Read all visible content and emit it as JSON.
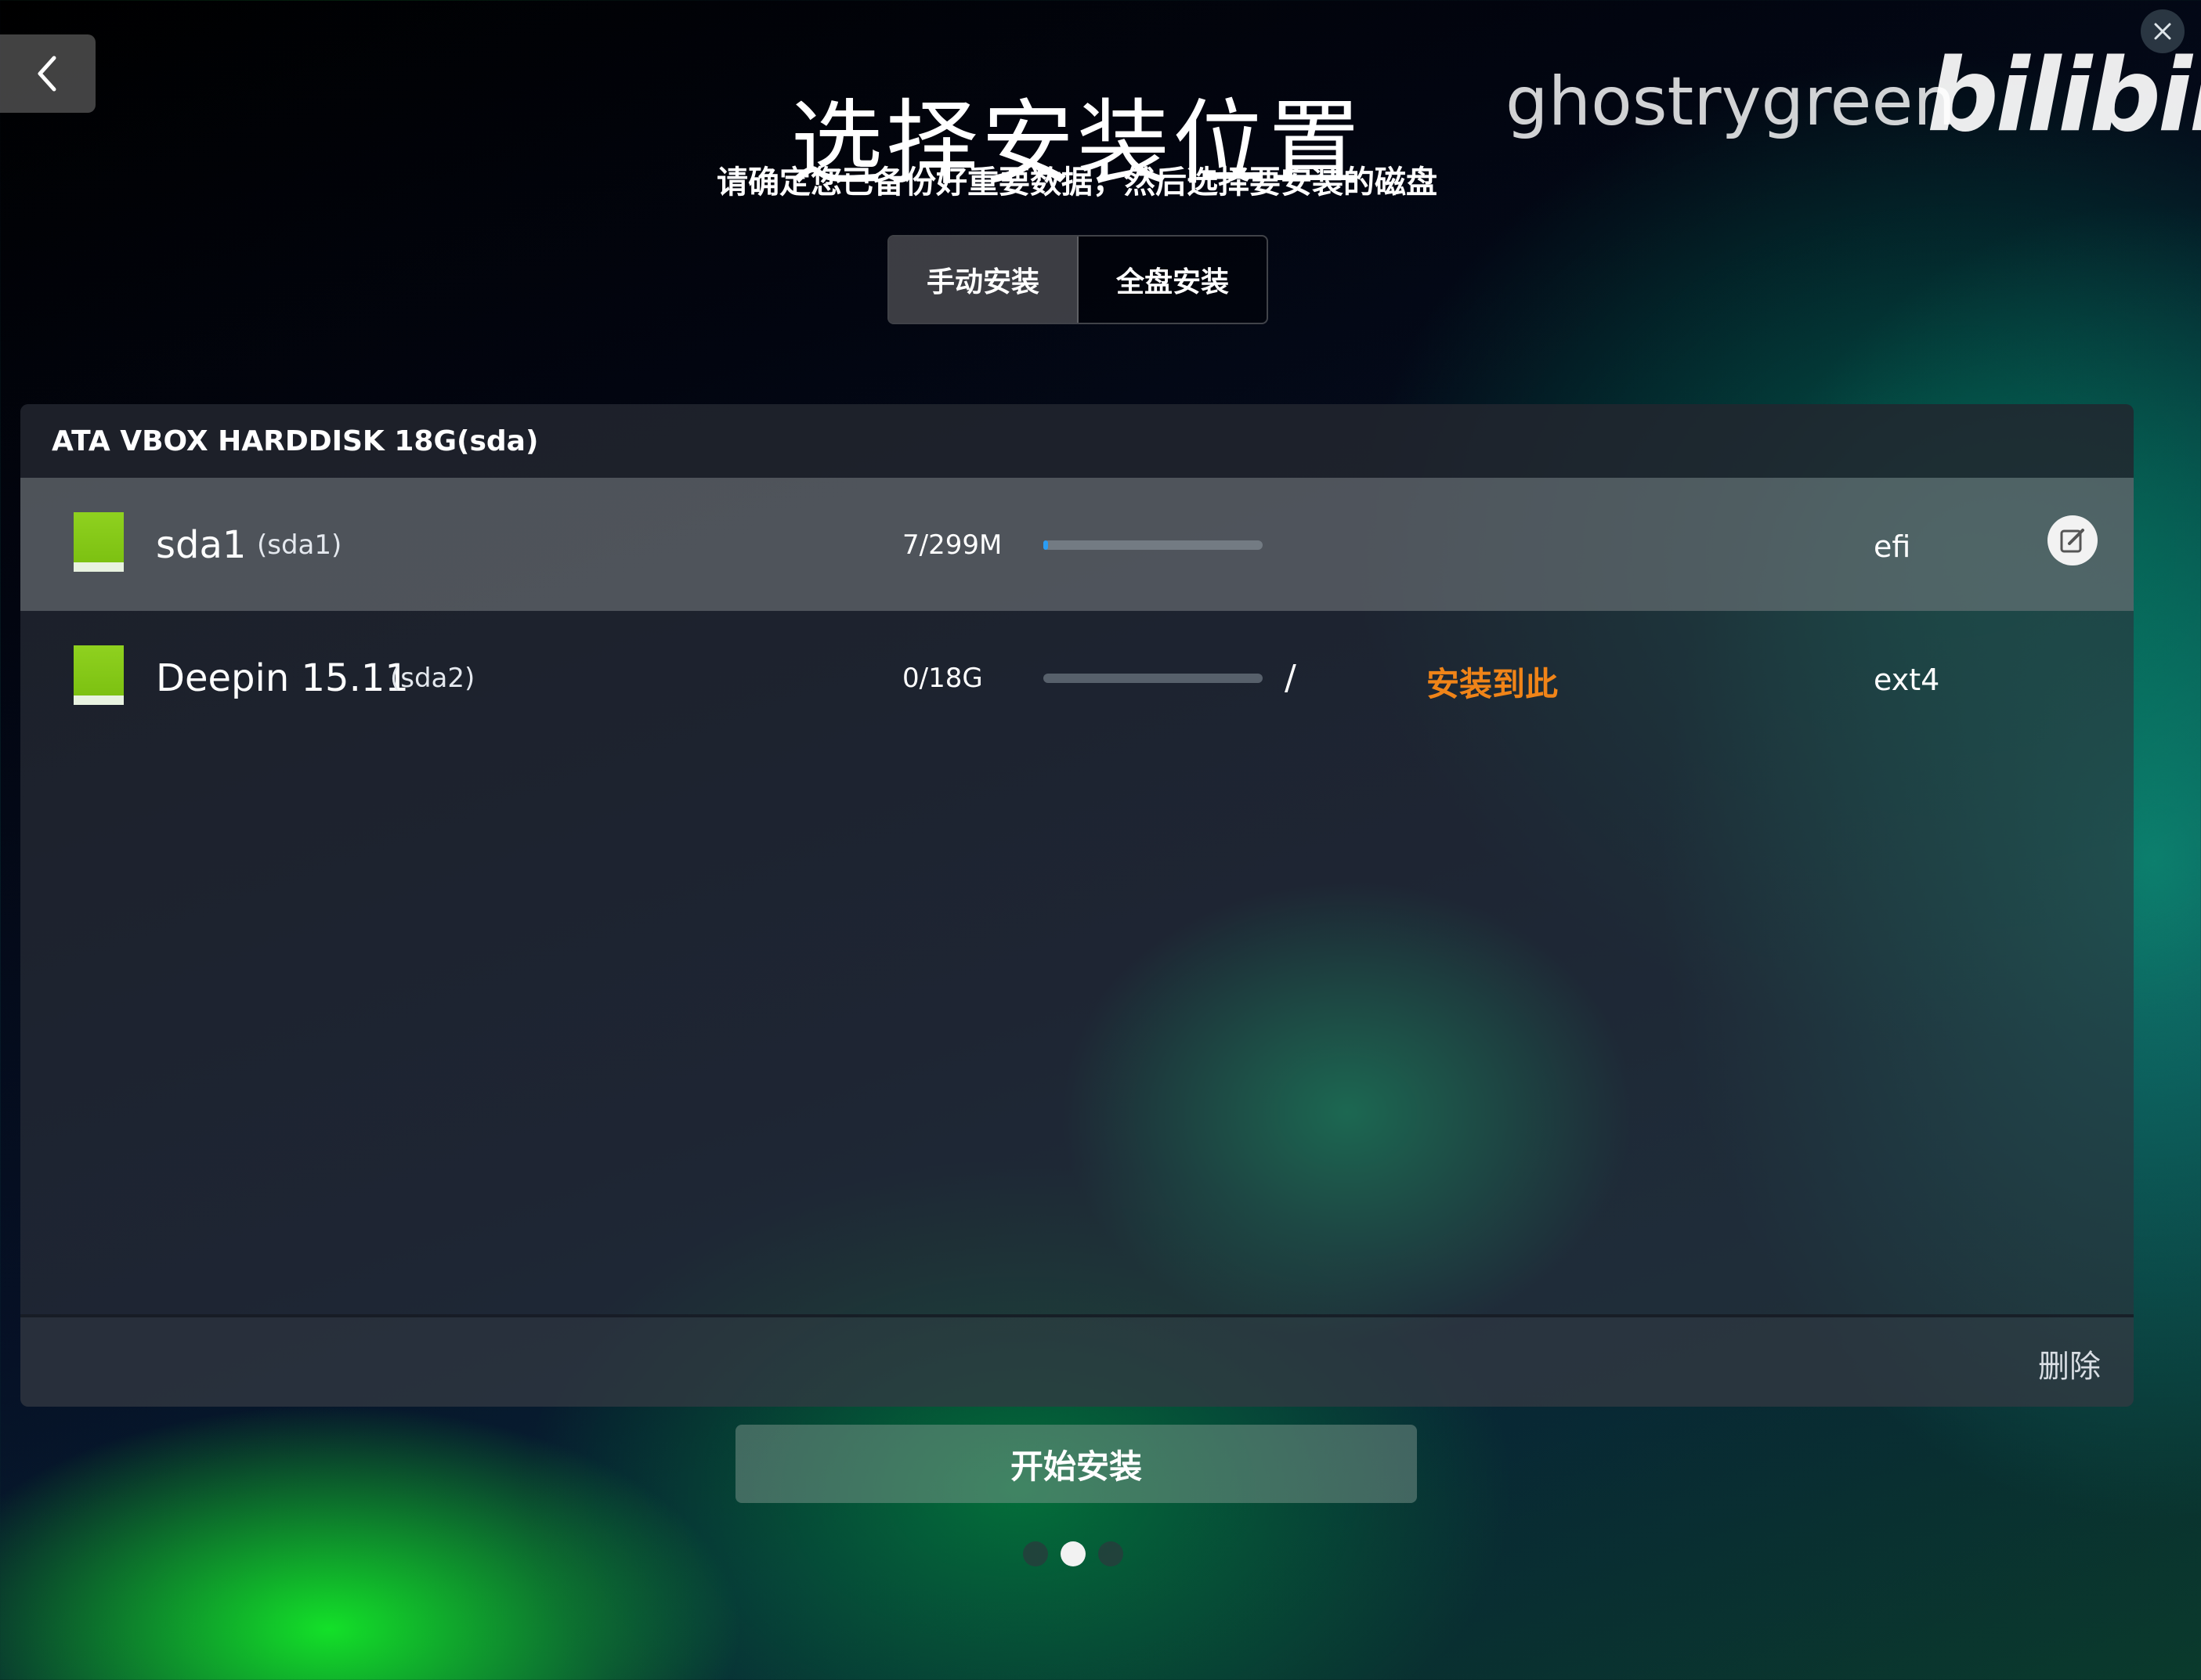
{
  "header": {
    "title": "选择安装位置",
    "subtitle": "请确定您已备份好重要数据，然后选择要安装的磁盘",
    "back_icon": "chevron-left-icon",
    "close_icon": "close-icon"
  },
  "watermark": {
    "user": "ghostrygreen",
    "logo": "bilibili"
  },
  "tabs": [
    {
      "label": "手动安装",
      "active": true
    },
    {
      "label": "全盘安装",
      "active": false
    }
  ],
  "disk": {
    "header": "ATA VBOX HARDDISK 18G(sda)",
    "partitions": [
      {
        "name": "sda1",
        "device": "(sda1)",
        "size": "7/299M",
        "usage_fraction": 0.02,
        "mount_point": "",
        "install_target": "",
        "filesystem": "efi",
        "selected": true
      },
      {
        "name": "Deepin 15.11",
        "device": "(sda2)",
        "size": "0/18G",
        "usage_fraction": 0.0,
        "mount_point": "/",
        "install_target": "安装到此",
        "filesystem": "ext4",
        "selected": false
      }
    ]
  },
  "footer": {
    "delete_label": "删除"
  },
  "start_button": {
    "label": "开始安装"
  },
  "pagination": {
    "total": 3,
    "current": 2
  },
  "colors": {
    "accent_orange": "#f08418",
    "partition_green": "#8fd11f",
    "usage_blue": "#2a9df4"
  }
}
